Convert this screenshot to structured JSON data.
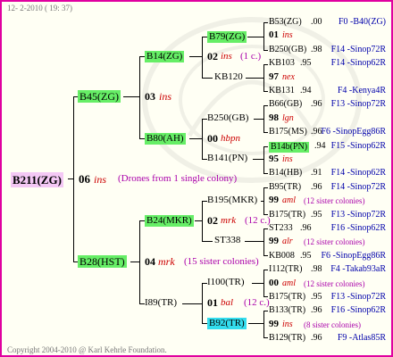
{
  "date_stamp": "12- 2-2010 ( 19: 37)",
  "copyright": "Copyright 2004-2010 @ Karl Kehrle Foundation.",
  "root": {
    "name": "B211(ZG)",
    "year": "06",
    "mark": "ins",
    "note": "(Drones from 1 single colony)"
  },
  "gen1": {
    "dam": {
      "name": "B45(ZG)",
      "year": "03",
      "mark": "ins"
    },
    "sire": {
      "name": "B28(HST)",
      "year": "04",
      "mark": "mrk",
      "note": "(15 sister colonies)"
    }
  },
  "gen2": {
    "b14": {
      "name": "B14(ZG)",
      "year": "02",
      "mark": "ins",
      "note": "(1 c.)"
    },
    "kb120": {
      "name": "KB120"
    },
    "b80": {
      "name": "B80(AH)",
      "year": "00",
      "mark": "hbpn"
    },
    "b141": {
      "name": "B141(PN)"
    },
    "b24": {
      "name": "B24(MKR)",
      "year": "02",
      "mark": "mrk",
      "note": "(12 c.)"
    },
    "st338": {
      "name": "ST338"
    },
    "i89": {
      "name": "I89(TR)",
      "year": "01",
      "mark": "bal",
      "note": "(12 c.)"
    },
    "i100": {
      "name": "I100(TR)"
    },
    "b92": {
      "name": "B92(TR)"
    },
    "b79": {
      "name": "B79(ZG)"
    },
    "b250": {
      "name": "B250(GB)"
    },
    "b195": {
      "name": "B195(MKR)"
    }
  },
  "rows": [
    {
      "name": "B53(ZG)",
      "val": ".00",
      "code": "F0 -B40(ZG)"
    },
    {
      "year": "01",
      "mark": "ins"
    },
    {
      "name": "B250(GB)",
      "val": ".98",
      "code": "F14 -Sinop72R"
    },
    {
      "name": "KB103",
      "val": ".95",
      "code": "F14 -Sinop62R"
    },
    {
      "year": "97",
      "mark": "nex"
    },
    {
      "name": "KB131",
      "val": ".94",
      "code": "F4 -Kenya4R"
    },
    {
      "name": "B66(GB)",
      "val": ".96",
      "code": "F13 -Sinop72R"
    },
    {
      "year": "98",
      "mark": "lgn"
    },
    {
      "name": "B175(MS)",
      "val": ".96",
      "code": "F6 -SinopEgg86R"
    },
    {
      "name": "B14b(PN)",
      "val": ".94",
      "code": "F15 -Sinop62R"
    },
    {
      "year": "95",
      "mark": "ins"
    },
    {
      "name": "B14(HB)",
      "val": ".91",
      "code": "F14 -Sinop62R"
    },
    {
      "name": "B95(TR)",
      "val": ".96",
      "code": "F14 -Sinop72R"
    },
    {
      "year": "99",
      "mark": "aml",
      "note": "(12 sister colonies)"
    },
    {
      "name": "B175(TR)",
      "val": ".95",
      "code": "F13 -Sinop72R"
    },
    {
      "name": "ST233",
      "val": ".96",
      "code": "F16 -Sinop62R"
    },
    {
      "year": "99",
      "mark": "alr",
      "note": "(12 sister colonies)"
    },
    {
      "name": "KB008",
      "val": ".95",
      "code": "F6 -SinopEgg86R"
    },
    {
      "name": "I112(TR)",
      "val": ".98",
      "code": "F4 -Takab93aR"
    },
    {
      "year": "00",
      "mark": "aml",
      "note": "(12 sister colonies)"
    },
    {
      "name": "B175(TR)",
      "val": ".95",
      "code": "F13 -Sinop72R"
    },
    {
      "name": "B133(TR)",
      "val": ".96",
      "code": "F16 -Sinop62R"
    },
    {
      "year": "99",
      "mark": "ins",
      "note": "(8 sister colonies)"
    },
    {
      "name": "B129(TR)",
      "val": ".96",
      "code": "F9 -Atlas85R"
    }
  ]
}
